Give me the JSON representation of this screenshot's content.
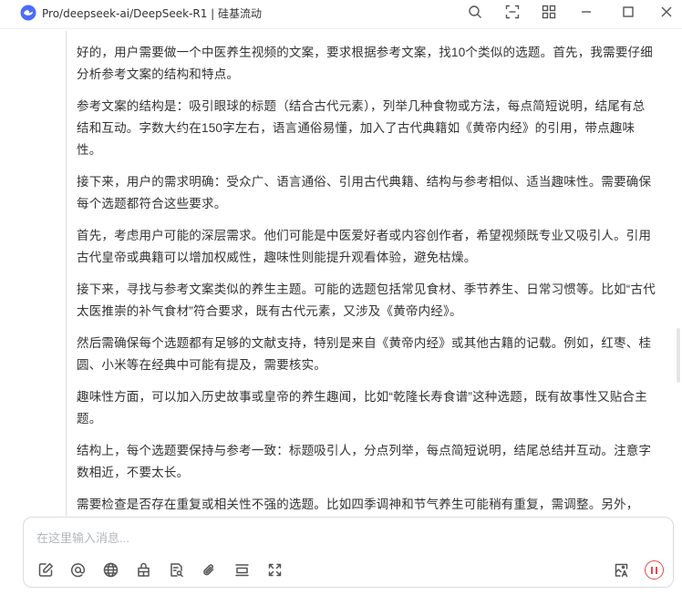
{
  "window": {
    "title": "Pro/deepseek-ai/DeepSeek-R1 | 硅基流动"
  },
  "titlebar_icons": [
    "search-icon",
    "capture-icon",
    "grid-icon",
    "minimize-icon",
    "maximize-icon",
    "close-icon"
  ],
  "thinking": {
    "paragraphs": [
      "好的，用户需要做一个中医养生视频的文案，要求根据参考文案，找10个类似的选题。首先，我需要仔细分析参考文案的结构和特点。",
      "参考文案的结构是：吸引眼球的标题（结合古代元素），列举几种食物或方法，每点简短说明，结尾有总结和互动。字数大约在150字左右，语言通俗易懂，加入了古代典籍如《黄帝内经》的引用，带点趣味性。",
      "接下来，用户的需求明确：受众广、语言通俗、引用古代典籍、结构与参考相似、适当趣味性。需要确保每个选题都符合这些要求。",
      "首先，考虑用户可能的深层需求。他们可能是中医爱好者或内容创作者，希望视频既专业又吸引人。引用古代皇帝或典籍可以增加权威性，趣味性则能提升观看体验，避免枯燥。",
      "接下来，寻找与参考文案类似的养生主题。可能的选题包括常见食材、季节养生、日常习惯等。比如“古代太医推崇的补气食材”符合要求，既有古代元素，又涉及《黄帝内经》。",
      "然后需确保每个选题都有足够的文献支持，特别是来自《黄帝内经》或其他古籍的记载。例如，红枣、桂圆、小米等在经典中可能有提及，需要核实。",
      "趣味性方面，可以加入历史故事或皇帝的养生趣闻，比如“乾隆长寿食谱”这种选题，既有故事性又贴合主题。",
      "结构上，每个选题要保持与参考一致：标题吸引人，分点列举，每点简短说明，结尾总结并互动。注意字数相近，不要太长。",
      "需要检查是否存在重复或相关性不强的选题。比如四季调神和节气养生可能稍有重复，需调整。另外，"
    ]
  },
  "input": {
    "placeholder": "在这里输入消息...",
    "value": ""
  },
  "toolbar_icons": [
    "edit-icon",
    "mention-icon",
    "globe-icon",
    "knowledge-base-icon",
    "search-document-icon",
    "attachment-icon",
    "clear-icon",
    "expand-icon",
    "image-translate-icon"
  ],
  "accent_colors": {
    "stop": "#e5484d",
    "logo": "#4d6bfe"
  }
}
